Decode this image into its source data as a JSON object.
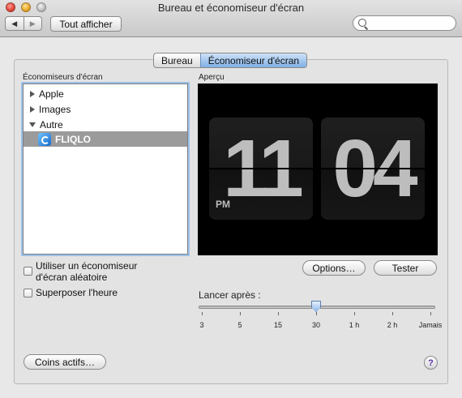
{
  "window": {
    "title": "Bureau et économiseur d'écran"
  },
  "toolbar": {
    "back_icon": "◀",
    "forward_icon": "▶",
    "show_all_label": "Tout afficher",
    "search_placeholder": ""
  },
  "tabs": [
    {
      "label": "Bureau",
      "active": false
    },
    {
      "label": "Économiseur d'écran",
      "active": true
    }
  ],
  "screensavers": {
    "section_label": "Économiseurs d'écran",
    "items": [
      {
        "label": "Apple",
        "type": "group",
        "expanded": false
      },
      {
        "label": "Images",
        "type": "group",
        "expanded": false
      },
      {
        "label": "Autre",
        "type": "group",
        "expanded": true
      },
      {
        "label": "FLIQLO",
        "type": "item",
        "selected": true,
        "icon": "fliqlo-icon"
      }
    ]
  },
  "preview": {
    "section_label": "Aperçu",
    "hour": "11",
    "minute": "04",
    "ampm": "PM"
  },
  "buttons": {
    "options_label": "Options…",
    "test_label": "Tester",
    "hot_corners_label": "Coins actifs…"
  },
  "options": {
    "random_label": "Utiliser un économiseur d'écran aléatoire",
    "random_checked": false,
    "clock_label": "Superposer l'heure",
    "clock_checked": false
  },
  "start_after": {
    "label": "Lancer après :",
    "ticks": [
      "3",
      "5",
      "15",
      "30",
      "1 h",
      "2 h",
      "Jamais"
    ],
    "selected": "30"
  },
  "help": {
    "icon": "?"
  },
  "colors": {
    "selection": "#9b9b9b",
    "focus_ring": "#9cc1ea",
    "help_glyph": "#5b2fa8"
  }
}
